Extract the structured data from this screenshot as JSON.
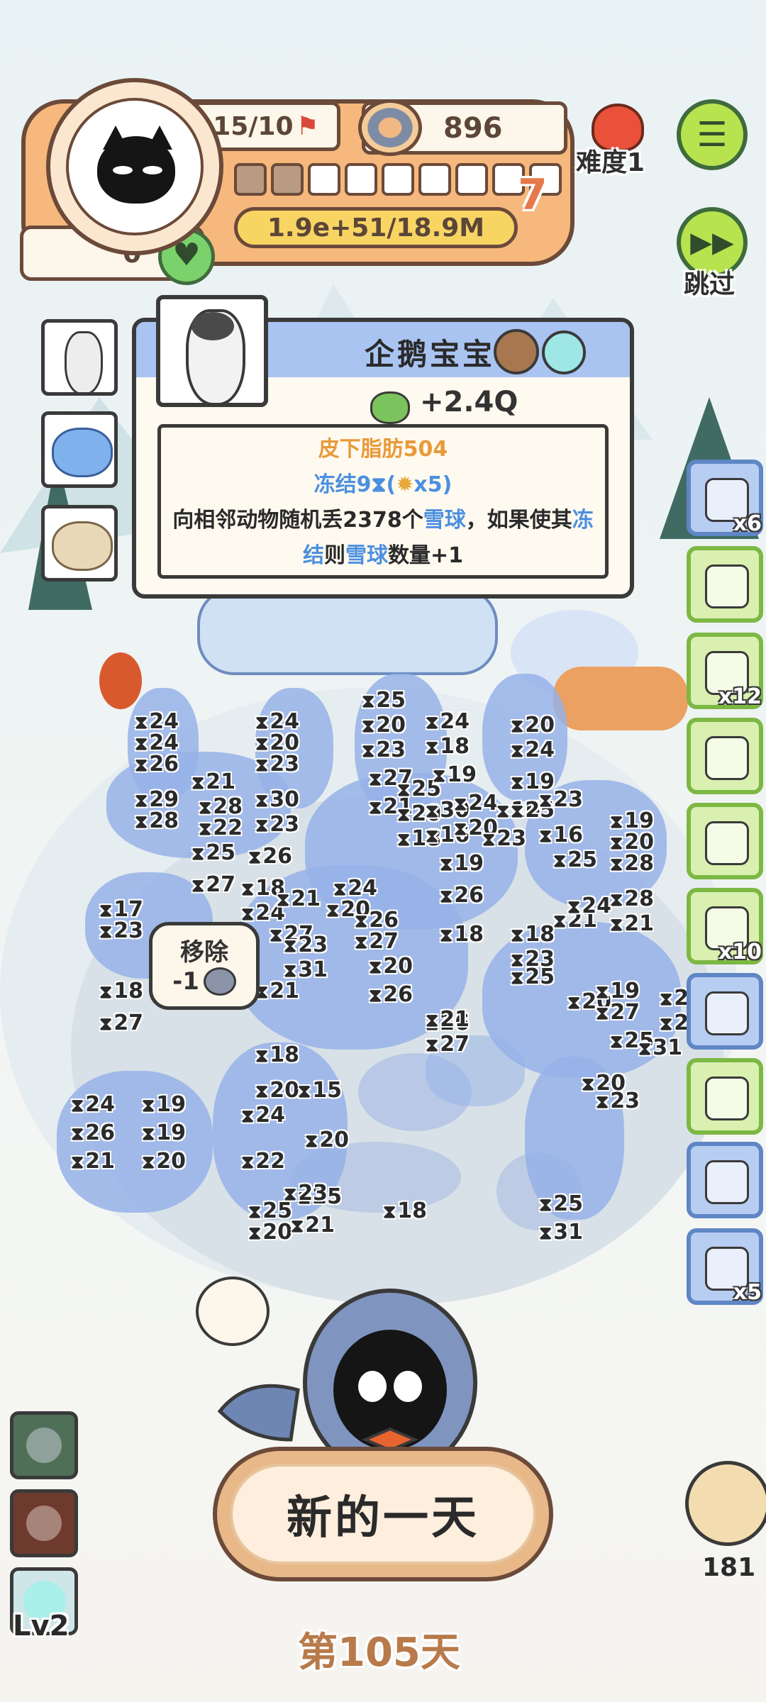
{
  "hud": {
    "flag_count": "15/10",
    "coins": "896",
    "level": "7",
    "progress": {
      "filled": 2,
      "total": 9
    },
    "score": "1.9e+51/18.9M",
    "hearts": "0"
  },
  "top_right": {
    "difficulty_label": "难度1",
    "skip_label": "跳过",
    "menu_icon": "menu-icon",
    "skip_icon": "fast-forward-icon"
  },
  "info_card": {
    "name": "企鹅宝宝",
    "income": "+2.4Q",
    "trait": "皮下脂肪504",
    "freeze": "冻结9",
    "freeze_mult": "x5",
    "desc_part1": "向相邻动物随机丢2378个",
    "snowball1": "雪球",
    "desc_part2": "，如果使其",
    "freeze_word1": "冻",
    "freeze_word2": "结",
    "desc_part3": "则",
    "snowball2": "雪球",
    "desc_part4": "数量+1"
  },
  "right_items": [
    {
      "icon": "fireplace-icon",
      "count": "x6"
    },
    {
      "icon": "snow-globe-icon",
      "count": ""
    },
    {
      "icon": "hot-cocoa-icon",
      "count": "x12"
    },
    {
      "icon": "card-icon",
      "count": ""
    },
    {
      "icon": "ticket-icon",
      "count": ""
    },
    {
      "icon": "refresh-ticket-icon",
      "count": "x10"
    },
    {
      "icon": "toy-mouse-icon",
      "count": ""
    },
    {
      "icon": "snow-globe-icon",
      "count": ""
    },
    {
      "icon": "coupon-icon",
      "count": ""
    },
    {
      "icon": "charm-bag-icon",
      "count": "x5"
    }
  ],
  "frozen_numbers": [
    "24",
    "24",
    "26",
    "29",
    "28",
    "21",
    "28",
    "22",
    "25",
    "27",
    "24",
    "20",
    "23",
    "30",
    "23",
    "26",
    "18",
    "24",
    "21",
    "27",
    "25",
    "20",
    "23",
    "27",
    "21",
    "25",
    "20",
    "30",
    "18",
    "16",
    "24",
    "18",
    "19",
    "24",
    "20",
    "23",
    "16",
    "20",
    "24",
    "19",
    "25",
    "23",
    "16",
    "25",
    "19",
    "20",
    "28",
    "28",
    "21",
    "24",
    "20",
    "26",
    "27",
    "19",
    "26",
    "18",
    "17",
    "23",
    "18",
    "27",
    "21",
    "23",
    "31",
    "20",
    "26",
    "26",
    "27",
    "21",
    "25",
    "18",
    "23",
    "21",
    "24",
    "20",
    "19",
    "27",
    "25",
    "21",
    "23",
    "31",
    "24",
    "26",
    "21",
    "19",
    "19",
    "20",
    "24",
    "22",
    "20",
    "18",
    "15",
    "20",
    "25",
    "20",
    "25",
    "18",
    "23",
    "21",
    "25",
    "31",
    "20",
    "23"
  ],
  "remove_tip": {
    "label": "移除",
    "value": "-1"
  },
  "new_day_label": "新的一天",
  "day_label": "第105天",
  "level_label": "Lv2",
  "owl_count": "181"
}
